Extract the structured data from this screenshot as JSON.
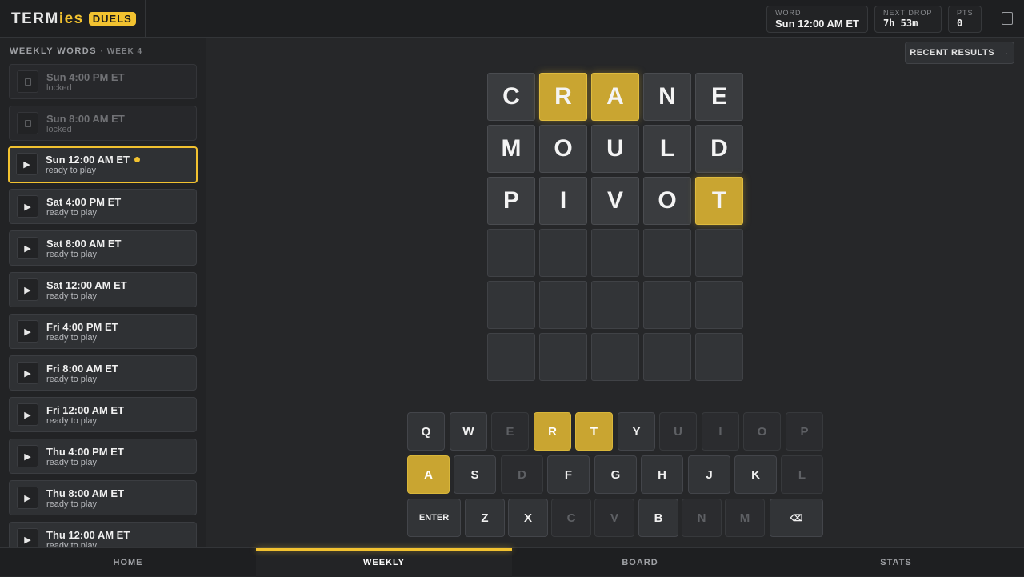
{
  "brand": {
    "name_a": "TERM",
    "name_b": "ies",
    "badge": "DUELS"
  },
  "stats": {
    "word": {
      "label": "WORD",
      "value": "Sun 12:00 AM ET"
    },
    "next_drop": {
      "label": "NEXT DROP",
      "value": "7h 53m"
    },
    "pts": {
      "label": "PTS",
      "value": "0"
    }
  },
  "sidebar": {
    "title": "WEEKLY WORDS",
    "week": "· WEEK 4",
    "items": [
      {
        "time": "Sun 4:00 PM ET",
        "status": "locked",
        "state": "locked",
        "icon": "lock-icon"
      },
      {
        "time": "Sun 8:00 AM ET",
        "status": "locked",
        "state": "locked",
        "icon": "lock-icon"
      },
      {
        "time": "Sun 12:00 AM ET",
        "status": "ready to play",
        "state": "active",
        "icon": "play-icon"
      },
      {
        "time": "Sat 4:00 PM ET",
        "status": "ready to play",
        "state": "ready",
        "icon": "play-icon"
      },
      {
        "time": "Sat 8:00 AM ET",
        "status": "ready to play",
        "state": "ready",
        "icon": "play-icon"
      },
      {
        "time": "Sat 12:00 AM ET",
        "status": "ready to play",
        "state": "ready",
        "icon": "play-icon"
      },
      {
        "time": "Fri 4:00 PM ET",
        "status": "ready to play",
        "state": "ready",
        "icon": "play-icon"
      },
      {
        "time": "Fri 8:00 AM ET",
        "status": "ready to play",
        "state": "ready",
        "icon": "play-icon"
      },
      {
        "time": "Fri 12:00 AM ET",
        "status": "ready to play",
        "state": "ready",
        "icon": "play-icon"
      },
      {
        "time": "Thu 4:00 PM ET",
        "status": "ready to play",
        "state": "ready",
        "icon": "play-icon"
      },
      {
        "time": "Thu 8:00 AM ET",
        "status": "ready to play",
        "state": "ready",
        "icon": "play-icon"
      },
      {
        "time": "Thu 12:00 AM ET",
        "status": "ready to play",
        "state": "ready",
        "icon": "play-icon"
      }
    ]
  },
  "recent_results": {
    "label": "RECENT RESULTS",
    "arrow": "→"
  },
  "board": {
    "rows": [
      [
        {
          "l": "C",
          "s": "absent"
        },
        {
          "l": "R",
          "s": "present"
        },
        {
          "l": "A",
          "s": "present"
        },
        {
          "l": "N",
          "s": "absent"
        },
        {
          "l": "E",
          "s": "absent"
        }
      ],
      [
        {
          "l": "M",
          "s": "absent"
        },
        {
          "l": "O",
          "s": "absent"
        },
        {
          "l": "U",
          "s": "absent"
        },
        {
          "l": "L",
          "s": "absent"
        },
        {
          "l": "D",
          "s": "absent"
        }
      ],
      [
        {
          "l": "P",
          "s": "absent"
        },
        {
          "l": "I",
          "s": "absent"
        },
        {
          "l": "V",
          "s": "absent"
        },
        {
          "l": "O",
          "s": "absent"
        },
        {
          "l": "T",
          "s": "present"
        }
      ],
      [
        {
          "l": "",
          "s": "empty"
        },
        {
          "l": "",
          "s": "empty"
        },
        {
          "l": "",
          "s": "empty"
        },
        {
          "l": "",
          "s": "empty"
        },
        {
          "l": "",
          "s": "empty"
        }
      ],
      [
        {
          "l": "",
          "s": "empty"
        },
        {
          "l": "",
          "s": "empty"
        },
        {
          "l": "",
          "s": "empty"
        },
        {
          "l": "",
          "s": "empty"
        },
        {
          "l": "",
          "s": "empty"
        }
      ],
      [
        {
          "l": "",
          "s": "empty"
        },
        {
          "l": "",
          "s": "empty"
        },
        {
          "l": "",
          "s": "empty"
        },
        {
          "l": "",
          "s": "empty"
        },
        {
          "l": "",
          "s": "empty"
        }
      ]
    ]
  },
  "keyboard": {
    "rows": [
      [
        {
          "k": "Q",
          "s": "unused"
        },
        {
          "k": "W",
          "s": "unused"
        },
        {
          "k": "E",
          "s": "absent"
        },
        {
          "k": "R",
          "s": "present"
        },
        {
          "k": "T",
          "s": "present"
        },
        {
          "k": "Y",
          "s": "unused"
        },
        {
          "k": "U",
          "s": "absent"
        },
        {
          "k": "I",
          "s": "absent"
        },
        {
          "k": "O",
          "s": "absent"
        },
        {
          "k": "P",
          "s": "absent"
        }
      ],
      [
        {
          "k": "A",
          "s": "present"
        },
        {
          "k": "S",
          "s": "unused"
        },
        {
          "k": "D",
          "s": "absent"
        },
        {
          "k": "F",
          "s": "unused"
        },
        {
          "k": "G",
          "s": "unused"
        },
        {
          "k": "H",
          "s": "unused"
        },
        {
          "k": "J",
          "s": "unused"
        },
        {
          "k": "K",
          "s": "unused"
        },
        {
          "k": "L",
          "s": "absent"
        }
      ],
      [
        {
          "k": "ENTER",
          "s": "unused",
          "wide": true
        },
        {
          "k": "Z",
          "s": "unused"
        },
        {
          "k": "X",
          "s": "unused"
        },
        {
          "k": "C",
          "s": "absent"
        },
        {
          "k": "V",
          "s": "absent"
        },
        {
          "k": "B",
          "s": "unused"
        },
        {
          "k": "N",
          "s": "absent"
        },
        {
          "k": "M",
          "s": "absent"
        },
        {
          "k": "⌫",
          "s": "unused",
          "wide": true
        }
      ]
    ]
  },
  "nav": [
    {
      "label": "HOME",
      "active": false
    },
    {
      "label": "WEEKLY",
      "active": true
    },
    {
      "label": "BOARD",
      "active": false
    },
    {
      "label": "STATS",
      "active": false
    }
  ],
  "colors": {
    "accent": "#f2c230",
    "present": "#c9a531",
    "tile": "#3a3c3f",
    "background": "#262729"
  }
}
